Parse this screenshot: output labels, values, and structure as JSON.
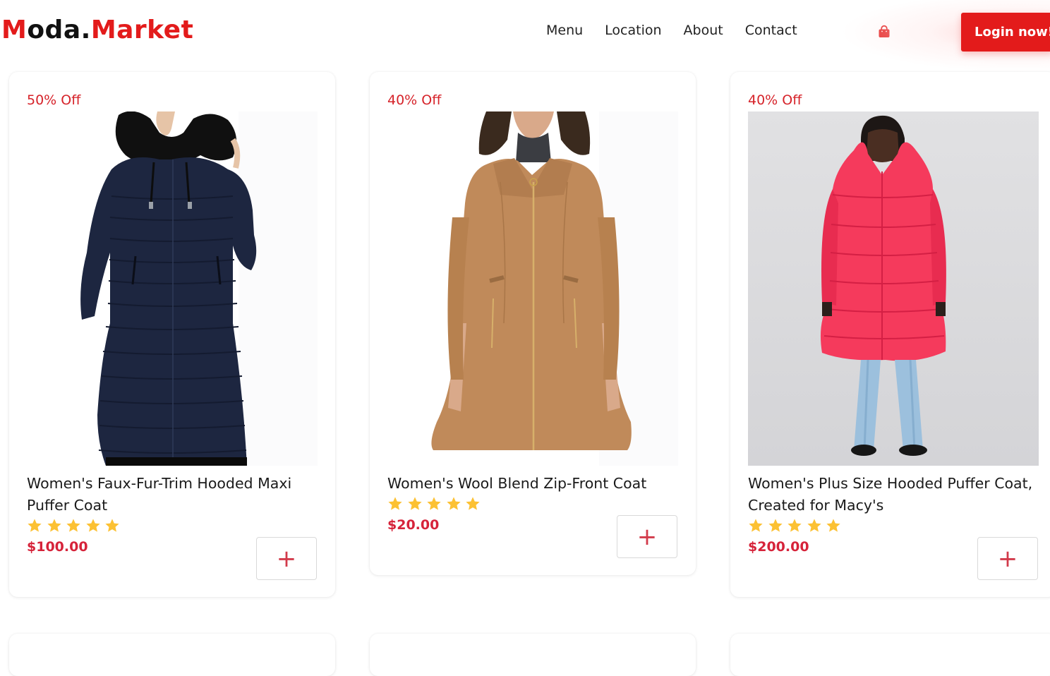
{
  "brand": {
    "part1": "M",
    "part2": "oda.",
    "part3": "Market"
  },
  "nav": {
    "menu": "Menu",
    "location": "Location",
    "about": "About",
    "contact": "Contact"
  },
  "cart_icon": "shopping-bag-icon",
  "login_label": "Login now!",
  "colors": {
    "accent": "#e31b1b",
    "price": "#d6233a",
    "star": "#fcc133"
  },
  "products": [
    {
      "discount": "50% Off",
      "name": "Women's Faux-Fur-Trim Hooded Maxi Puffer Coat",
      "rating": 5,
      "price": "$100.00",
      "add_label": "+"
    },
    {
      "discount": "40% Off",
      "name": "Women's Wool Blend Zip-Front Coat",
      "rating": 5,
      "price": "$20.00",
      "add_label": "+"
    },
    {
      "discount": "40% Off",
      "name": "Women's Plus Size Hooded Puffer Coat, Created for Macy's",
      "rating": 5,
      "price": "$200.00",
      "add_label": "+"
    }
  ]
}
